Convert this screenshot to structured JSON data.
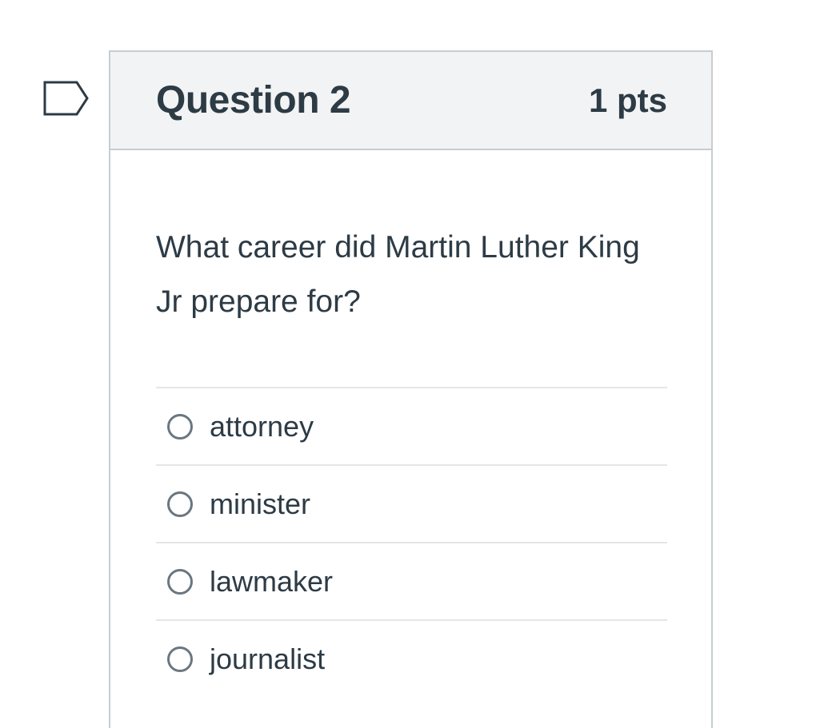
{
  "question": {
    "title": "Question 2",
    "points": "1 pts",
    "text": "What career did Martin Luther King Jr prepare for?",
    "flag_icon": "flag-outline-icon",
    "answers": [
      {
        "label": "attorney",
        "selected": false
      },
      {
        "label": "minister",
        "selected": false
      },
      {
        "label": "lawmaker",
        "selected": false
      },
      {
        "label": "journalist",
        "selected": false
      }
    ]
  },
  "colors": {
    "text": "#2d3b45",
    "header_bg": "#f2f3f4",
    "border": "#c7cdd1",
    "divider": "#e3e6e8",
    "radio_border": "#6b7780"
  }
}
